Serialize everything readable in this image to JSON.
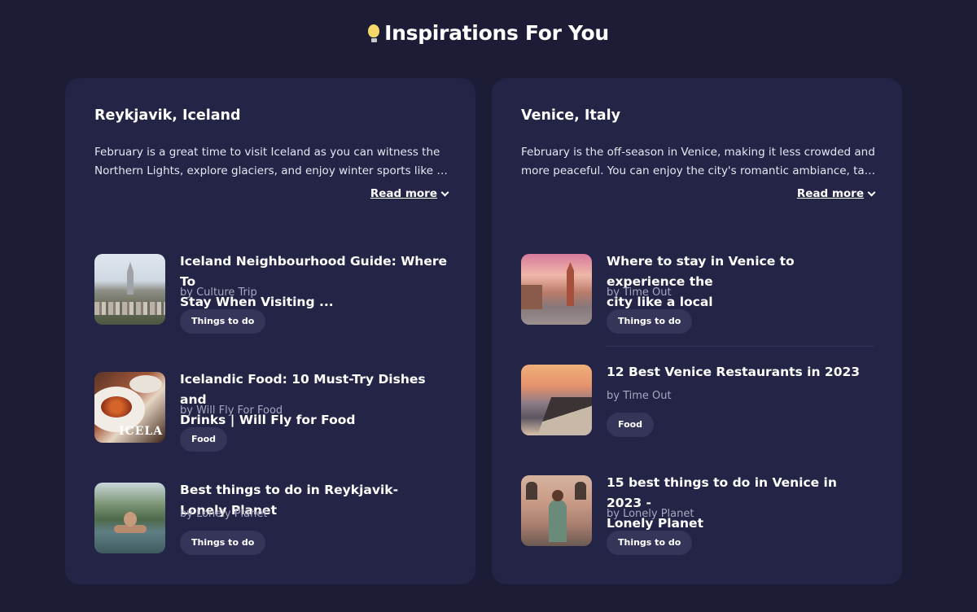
{
  "header": {
    "title": "Inspirations For You",
    "icon": "lightbulb-icon"
  },
  "read_more_label": "Read more",
  "cards": [
    {
      "city": "Reykjavik, Iceland",
      "description_lines": [
        "February is a great time to visit Iceland as you can witness the",
        "Northern Lights, explore glaciers, and enjoy winter sports like skiing..."
      ],
      "articles": [
        {
          "title_lines": [
            "Iceland Neighbourhood Guide: Where To",
            "Stay When Visiting ..."
          ],
          "source": "by Culture Trip",
          "tag": "Things to do",
          "thumb_text": ""
        },
        {
          "title_lines": [
            "Icelandic Food: 10 Must-Try Dishes and",
            "Drinks | Will Fly for Food"
          ],
          "source": "by Will Fly For Food",
          "tag": "Food",
          "thumb_text": "ICELA"
        },
        {
          "title_lines": [
            "Best things to do in Reykjavik- Lonely Planet"
          ],
          "source": "by Lonely Planet",
          "tag": "Things to do",
          "thumb_text": ""
        }
      ]
    },
    {
      "city": "Venice, Italy",
      "description_lines": [
        "February is the off-season in Venice, making it less crowded and",
        "more peaceful. You can enjoy the city's romantic ambiance, take a..."
      ],
      "articles": [
        {
          "title_lines": [
            "Where to stay in Venice to experience the",
            "city like a local"
          ],
          "source": "by Time Out",
          "tag": "Things to do"
        },
        {
          "title_lines": [
            "12 Best Venice Restaurants in 2023"
          ],
          "source": "by Time Out",
          "tag": "Food"
        },
        {
          "title_lines": [
            "15 best things to do in Venice in 2023 -",
            "Lonely Planet"
          ],
          "source": "by Lonely Planet",
          "tag": "Things to do"
        }
      ]
    }
  ],
  "colors": {
    "background": "#1c1c36",
    "card": "#242446",
    "tag": "#35355a",
    "source_text": "#a7a7bf"
  }
}
